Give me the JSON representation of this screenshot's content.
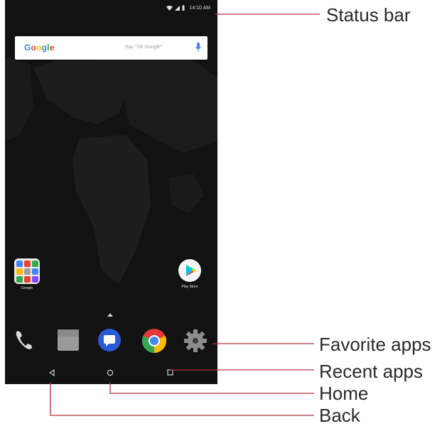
{
  "status_bar": {
    "time": "14:10 AM"
  },
  "search_widget": {
    "logo_letters": [
      {
        "char": "G",
        "color": "#4285F4"
      },
      {
        "char": "o",
        "color": "#EA4335"
      },
      {
        "char": "o",
        "color": "#FBBC05"
      },
      {
        "char": "g",
        "color": "#4285F4"
      },
      {
        "char": "l",
        "color": "#34A853"
      },
      {
        "char": "e",
        "color": "#EA4335"
      }
    ],
    "hint": "Say \"Ok Google\""
  },
  "home_apps": [
    {
      "label": "Google"
    },
    {
      "label": "Play Store"
    }
  ],
  "dock": [
    "phone-icon",
    "contacts-icon",
    "messages-icon",
    "chrome-icon",
    "settings-icon"
  ],
  "callouts": {
    "status_bar": "Status bar",
    "favorite_apps": "Favorite apps",
    "recent_apps": "Recent apps",
    "home": "Home",
    "back": "Back"
  },
  "colors": {
    "leader_line": "#b5303a",
    "phone_bg": "#121212"
  }
}
